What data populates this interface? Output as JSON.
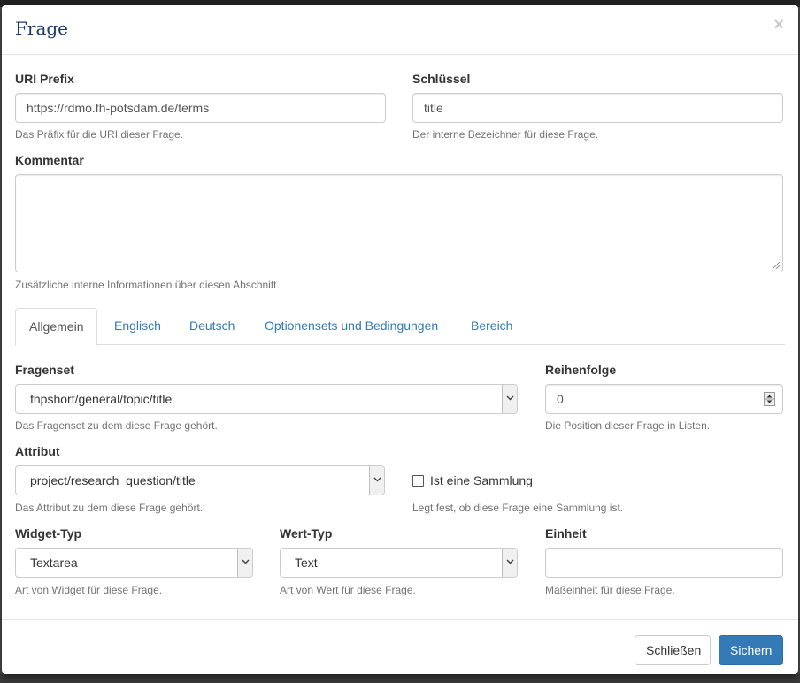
{
  "modal": {
    "title": "Frage",
    "close_symbol": "×"
  },
  "uri_prefix": {
    "label": "URI Prefix",
    "value": "https://rdmo.fh-potsdam.de/terms",
    "help": "Das Präfix für die URI dieser Frage."
  },
  "key": {
    "label": "Schlüssel",
    "value": "title",
    "help": "Der interne Bezeichner für diese Frage."
  },
  "comment": {
    "label": "Kommentar",
    "value": "",
    "help": "Zusätzliche interne Informationen über diesen Abschnitt."
  },
  "tabs": [
    {
      "label": "Allgemein",
      "active": true
    },
    {
      "label": "Englisch",
      "active": false
    },
    {
      "label": "Deutsch",
      "active": false
    },
    {
      "label": "Optionensets und Bedingungen",
      "active": false
    },
    {
      "label": "Bereich",
      "active": false
    }
  ],
  "questionset": {
    "label": "Fragenset",
    "value": "fhpshort/general/topic/title",
    "help": "Das Fragenset zu dem diese Frage gehört."
  },
  "order": {
    "label": "Reihenfolge",
    "value": "0",
    "help": "Die Position dieser Frage in Listen."
  },
  "attribute": {
    "label": "Attribut",
    "value": "project/research_question/title",
    "help": "Das Attribut zu dem diese Frage gehört."
  },
  "collection": {
    "label": "Ist eine Sammlung",
    "checked": false,
    "help": "Legt fest, ob diese Frage eine Sammlung ist."
  },
  "widget_type": {
    "label": "Widget-Typ",
    "value": "Textarea",
    "help": "Art von Widget für diese Frage."
  },
  "value_type": {
    "label": "Wert-Typ",
    "value": "Text",
    "help": "Art von Wert für diese Frage."
  },
  "unit": {
    "label": "Einheit",
    "value": "",
    "help": "Maßeinheit für diese Frage."
  },
  "footer": {
    "close_label": "Schließen",
    "save_label": "Sichern"
  },
  "colors": {
    "primary": "#337ab7",
    "title": "#1d3a6b",
    "tab_link": "#337ab7"
  }
}
